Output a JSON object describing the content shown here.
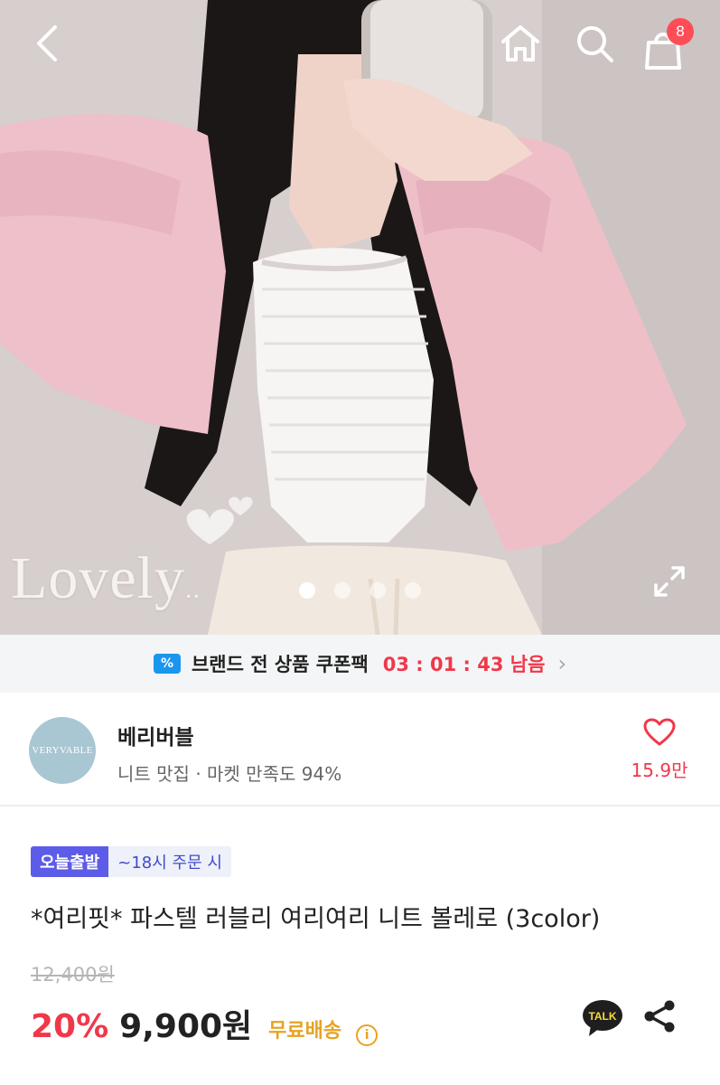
{
  "hero": {
    "overlay_text": "Lovely",
    "overlay_suffix": "..",
    "carousel_dots": 4,
    "active_dot": 0
  },
  "header": {
    "icons": [
      "back-icon",
      "home-icon",
      "search-icon",
      "shopping-bag-icon"
    ],
    "cart_count": "8"
  },
  "coupon_bar": {
    "icon": "coupon-icon",
    "text": "브랜드 전 상품 쿠폰팩",
    "timer": "03 : 01 : 43 남음",
    "chevron": "›"
  },
  "shop": {
    "logo_text": "VERYVABLE",
    "name": "베리버블",
    "meta": "니트 맛집 · 마켓 만족도 94%",
    "likes": "15.9만"
  },
  "product": {
    "delivery_badge": "오늘출발",
    "delivery_condition": "~18시 주문 시",
    "title": "*여리핏* 파스텔 러블리 여리여리 니트 볼레로 (3color)",
    "original_price": "12,400원",
    "discount": "20%",
    "price": "9,900원",
    "shipping": "무료배송",
    "info_glyph": "i",
    "talk_label": "TALK"
  },
  "colors": {
    "accent_red": "#f0384b",
    "shipping_gold": "#e6a323",
    "delivery_purple": "#5c5ce8",
    "coupon_blue": "#1a96f0"
  }
}
